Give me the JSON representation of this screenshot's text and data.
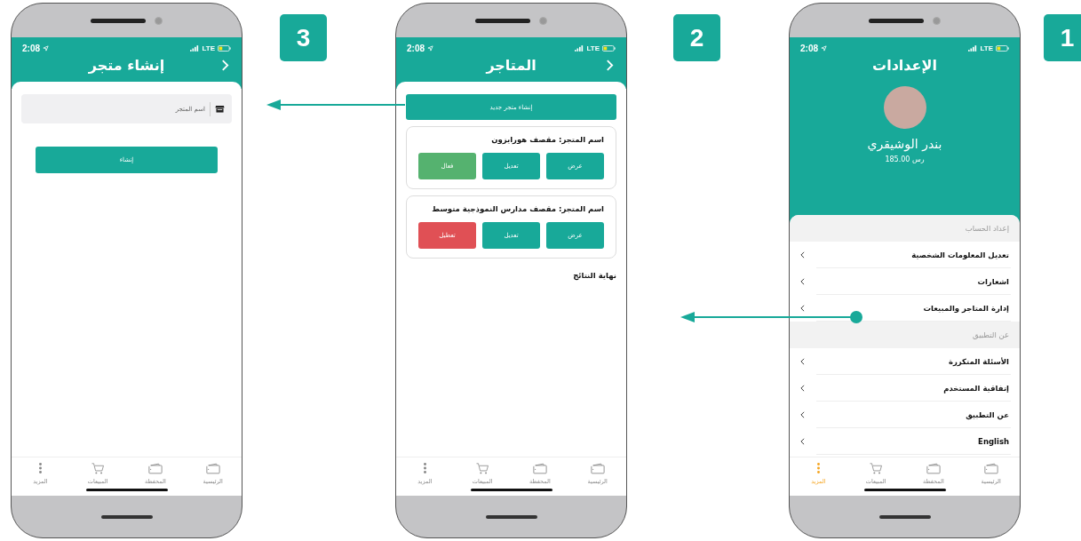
{
  "panels": [
    {
      "badge": "1",
      "screen": {
        "kind": "settings",
        "status": {
          "time": "2:08",
          "network": "LTE"
        },
        "back_button": false,
        "title": "الإعدادات",
        "profile": {
          "name": "بندر الوشيقري",
          "balance": "185.00 رس"
        },
        "sections": [
          {
            "header": "إعداد الحساب",
            "items": [
              "تعديل المعلومات الشخصية",
              "اشعارات",
              "إدارة المتاجر والمبيعات"
            ]
          },
          {
            "header": "عن التطبيق",
            "items": [
              "الأسئلة المتكررة",
              "إتفاقية المستخدم",
              "عن التطبيق",
              "English"
            ]
          }
        ],
        "tabs": [
          {
            "label": "الرئيسية",
            "kind": "home",
            "selected": false
          },
          {
            "label": "المحفظة",
            "kind": "wallet",
            "selected": false
          },
          {
            "label": "المبيعات",
            "kind": "cart",
            "selected": false
          },
          {
            "label": "المزيد",
            "kind": "more",
            "selected": true
          }
        ]
      }
    },
    {
      "badge": "2",
      "screen": {
        "kind": "stores",
        "status": {
          "time": "2:08",
          "network": "LTE"
        },
        "back_button": true,
        "title": "المتاجر",
        "new_store": "إنشاء متجر جديد",
        "stores": [
          {
            "name": "اسم المتجر: مقصف هورايزون",
            "actions": [
              {
                "label": "عرض",
                "kind": "normal"
              },
              {
                "label": "تعديل",
                "kind": "normal"
              },
              {
                "label": "فعال",
                "kind": "enable"
              }
            ]
          },
          {
            "name": "اسم المتجر: مقصف مدارس النموذجية متوسط",
            "actions": [
              {
                "label": "عرض",
                "kind": "normal"
              },
              {
                "label": "تعديل",
                "kind": "normal"
              },
              {
                "label": "تعطيل",
                "kind": "disable"
              }
            ]
          }
        ],
        "end_text": "نهاية النتائج",
        "tabs": [
          {
            "label": "الرئيسية",
            "kind": "home",
            "selected": false
          },
          {
            "label": "المحفظة",
            "kind": "wallet",
            "selected": false
          },
          {
            "label": "المبيعات",
            "kind": "cart",
            "selected": false
          },
          {
            "label": "المزيد",
            "kind": "more",
            "selected": false
          }
        ]
      }
    },
    {
      "badge": "3",
      "screen": {
        "kind": "create_store",
        "status": {
          "time": "2:08",
          "network": "LTE"
        },
        "back_button": true,
        "title": "إنشاء متجر",
        "field": {
          "placeholder": "اسم المتجر"
        },
        "submit": "إنشاء",
        "tabs": [
          {
            "label": "الرئيسية",
            "kind": "home",
            "selected": false
          },
          {
            "label": "المحفظة",
            "kind": "wallet",
            "selected": false
          },
          {
            "label": "المبيعات",
            "kind": "cart",
            "selected": false
          },
          {
            "label": "المزيد",
            "kind": "more",
            "selected": false
          }
        ]
      }
    }
  ]
}
